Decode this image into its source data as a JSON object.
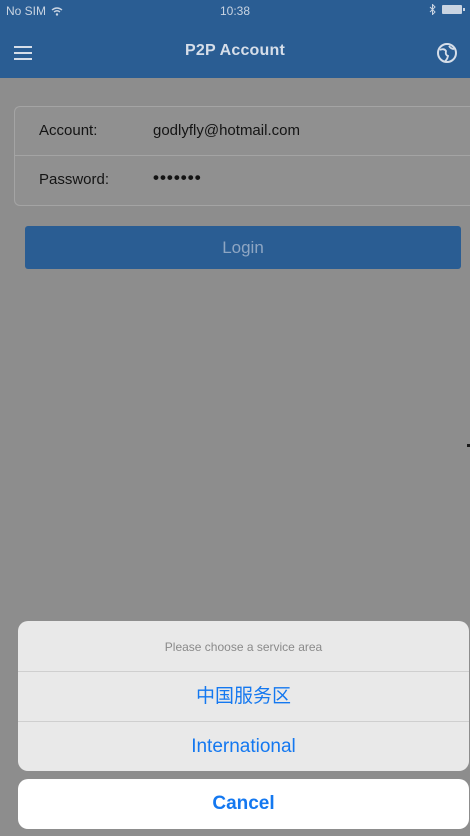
{
  "status_bar": {
    "carrier": "No SIM",
    "time": "10:38"
  },
  "nav": {
    "title": "P2P Account"
  },
  "form": {
    "account_label": "Account:",
    "account_value": "godlyfly@hotmail.com",
    "password_label": "Password:",
    "password_value": "•••••••"
  },
  "login": {
    "label": "Login"
  },
  "action_sheet": {
    "title": "Please choose a service area",
    "options": [
      "中国服务区",
      "International"
    ],
    "cancel_label": "Cancel"
  },
  "colors": {
    "nav_blue": "#2a5d93",
    "ios_blue": "#1478f0",
    "dim_background": "#8d8d8d"
  }
}
